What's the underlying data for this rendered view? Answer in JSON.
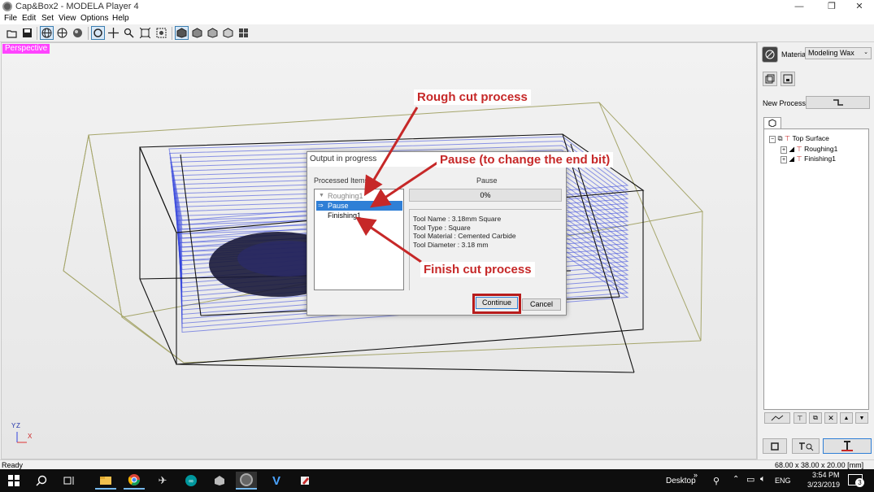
{
  "window": {
    "title": "Cap&Box2 - MODELA Player 4",
    "controls": [
      "—",
      "❐",
      "✕"
    ]
  },
  "menu": [
    "File",
    "Edit",
    "Set",
    "View",
    "Options",
    "Help"
  ],
  "viewport": {
    "label": "Perspective",
    "axes": {
      "y": "Y",
      "z": "Z",
      "x": "X"
    }
  },
  "dialog": {
    "title": "Output in progress",
    "processed_label": "Processed Items:",
    "items": [
      "Roughing1",
      "Pause",
      "Finishing1"
    ],
    "status": "Pause",
    "progress_text": "0%",
    "progress": 0,
    "tool_info": [
      "Tool Name : 3.18mm Square",
      "Tool Type : Square",
      "Tool Material : Cemented Carbide",
      "Tool Diameter : 3.18 mm"
    ],
    "continue_label": "Continue",
    "cancel_label": "Cancel"
  },
  "annotations": {
    "rough": "Rough cut process",
    "pause": "Pause (to change the  end bit)",
    "finish": "Finish cut process"
  },
  "right_panel": {
    "material_label": "Material",
    "material_value": "Modeling Wax",
    "new_process_label": "New Process",
    "tree": {
      "root": "Top Surface",
      "children": [
        "Roughing1",
        "Finishing1"
      ]
    }
  },
  "statusbar": {
    "left": "Ready",
    "right": "68.00 x 38.00 x 20.00 [mm]"
  },
  "taskbar": {
    "desktop": "Desktop",
    "lang": "ENG",
    "time": "3:54 PM",
    "date": "3/23/2019",
    "notifications": "3"
  }
}
